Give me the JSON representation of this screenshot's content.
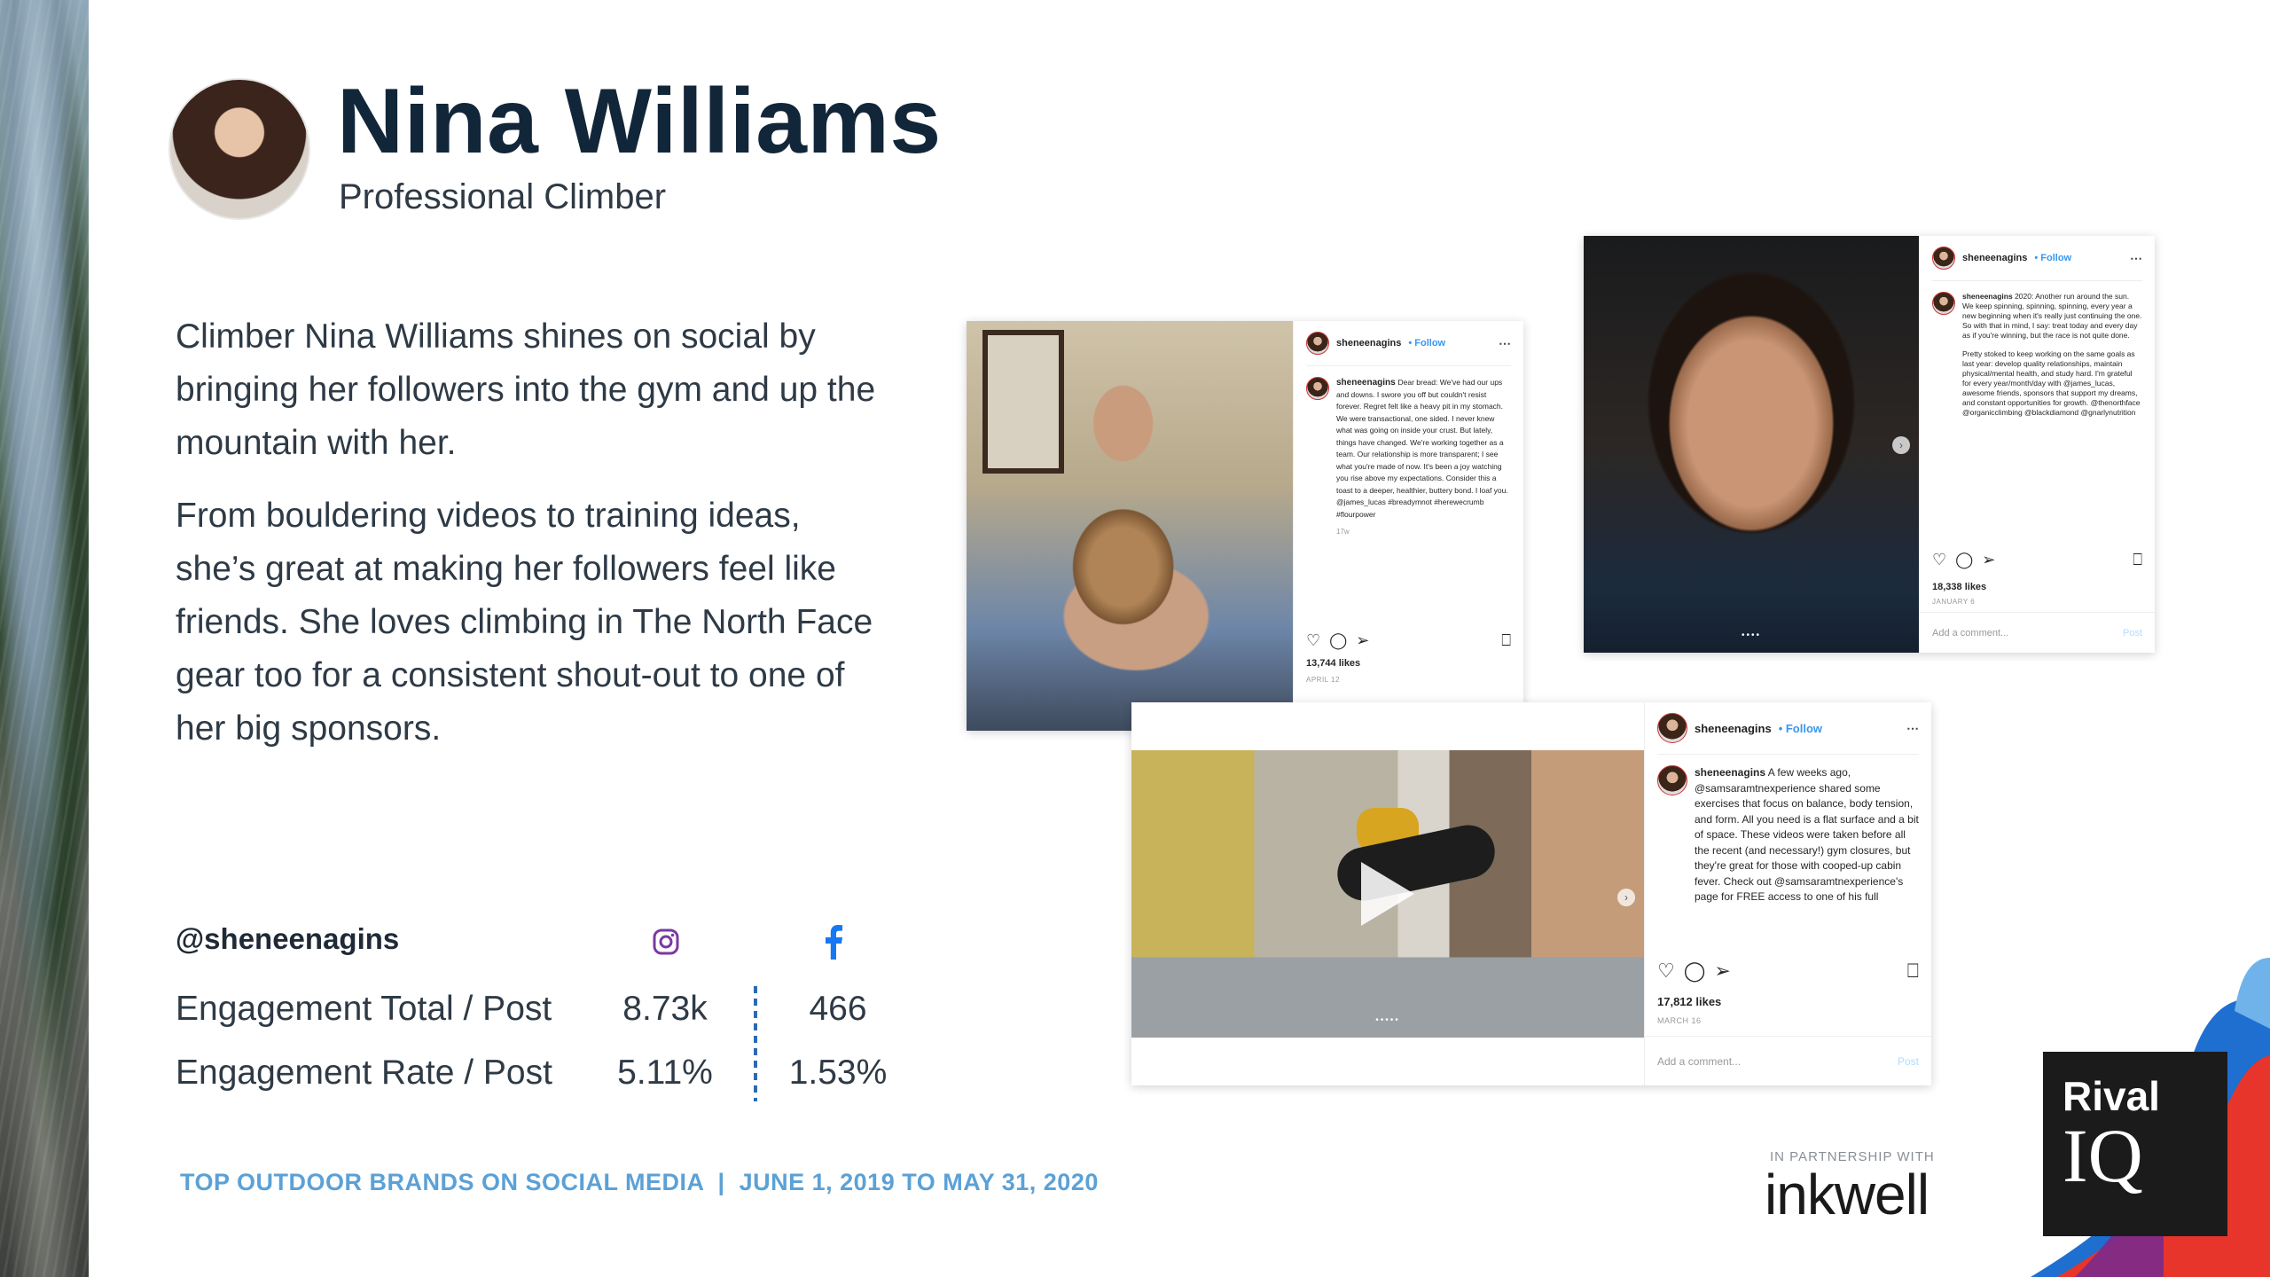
{
  "profile": {
    "name": "Nina Williams",
    "role": "Professional Climber"
  },
  "description": [
    "Climber Nina Williams shines on social by bringing her followers into the gym and up the mountain with her.",
    "From bouldering videos to training ideas, she’s great at making her followers feel like friends. She loves climbing in The North Face gear too for a consistent shout-out to one of her big sponsors."
  ],
  "stats": {
    "handle": "@sheneenagins",
    "icons": [
      "instagram-icon",
      "facebook-icon"
    ],
    "rows": [
      {
        "label": "Engagement Total / Post",
        "instagram": "8.73k",
        "facebook": "466"
      },
      {
        "label": "Engagement Rate / Post",
        "instagram": "5.11%",
        "facebook": "1.53%"
      }
    ]
  },
  "footer": {
    "caption": "TOP OUTDOOR BRANDS ON SOCIAL MEDIA  |  JUNE 1, 2019 TO MAY 31, 2020"
  },
  "posts": [
    {
      "username": "sheneenagins",
      "follow": "• Follow",
      "caption": "Dear bread: We've had our ups and downs. I swore you off but couldn't resist forever. Regret felt like a heavy pit in my stomach. We were transactional, one sided. I never knew what was going on inside your crust. But lately, things have changed. We're working together as a team. Our relationship is more transparent; I see what you're made of now. It's been a joy watching you rise above my expectations. Consider this a toast to a deeper, healthier, buttery bond. I loaf you. @james_lucas #breadymnot #herewecrumb #flourpower",
      "age": "17w",
      "likes": "13,744 likes",
      "date": "APRIL 12"
    },
    {
      "username": "sheneenagins",
      "follow": "• Follow",
      "caption": "2020: Another run around the sun. We keep spinning, spinning, spinning, every year a new beginning when it's really just continuing the one. So with that in mind, I say: treat today and every day as if you're winning, but the race is not quite done.",
      "caption2": "Pretty stoked to keep working on the same goals as last year: develop quality relationships, maintain physical/mental health, and study hard. I'm grateful for every year/month/day with @james_lucas, awesome friends, sponsors that support my dreams, and constant opportunities for growth. @thenorthface @organicclimbing @blackdiamond @gnarlynutrition",
      "likes": "18,338 likes",
      "date": "JANUARY 6",
      "add_comment": "Add a comment...",
      "post_label": "Post"
    },
    {
      "username": "sheneenagins",
      "follow": "• Follow",
      "caption": "A few weeks ago, @samsaramtnexperience shared some exercises that focus on balance, body tension, and form. All you need is a flat surface and a bit of space. These videos were taken before all the recent (and necessary!) gym closures, but they're great for those with cooped-up cabin fever. Check out @samsaramtnexperience's page for FREE access to one of his full",
      "likes": "17,812 likes",
      "date": "MARCH 16",
      "add_comment": "Add a comment...",
      "post_label": "Post"
    }
  ],
  "branding": {
    "partner_label": "IN PARTNERSHIP WITH",
    "partner_name": "inkwell",
    "logo_line1": "Rival",
    "logo_line2": "IQ"
  }
}
